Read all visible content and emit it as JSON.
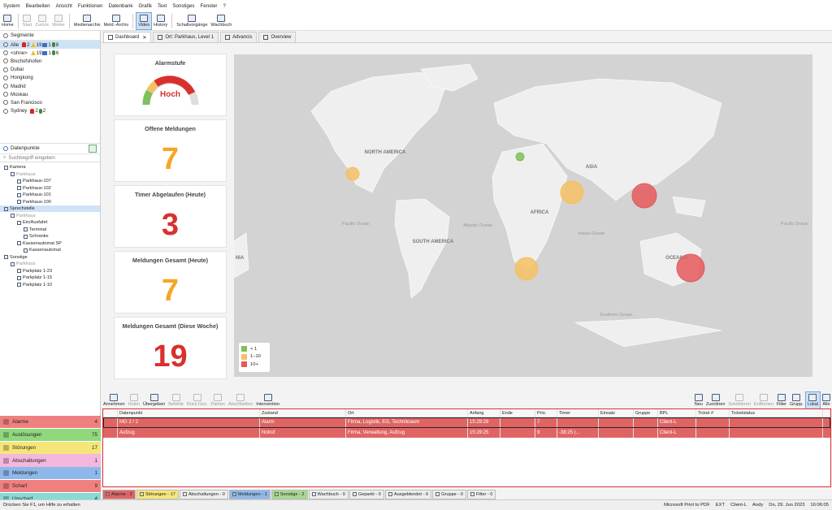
{
  "menu": [
    "System",
    "Bearbeiten",
    "Ansicht",
    "Funktionen",
    "Datenbank",
    "Grafik",
    "Text",
    "Sonstiges",
    "Fenster",
    "?"
  ],
  "toolbar": [
    {
      "label": "Home",
      "state": "normal"
    },
    {
      "label": "Start",
      "state": "disabled"
    },
    {
      "label": "Zurück",
      "state": "disabled"
    },
    {
      "label": "Weiter",
      "state": "disabled"
    },
    {
      "label": "Medienarchiv",
      "state": "normal"
    },
    {
      "label": "Meld.-Archiv",
      "state": "normal"
    },
    {
      "label": "Video",
      "state": "selected"
    },
    {
      "label": "History",
      "state": "normal"
    },
    {
      "label": "Schaltvorgänge",
      "state": "normal"
    },
    {
      "label": "Wachbuch",
      "state": "normal"
    }
  ],
  "segments": {
    "title": "Segmente",
    "items": [
      {
        "label": "Alle",
        "alarm": "2",
        "warn": "19",
        "msg": "1",
        "pin": "8",
        "selected": true
      },
      {
        "label": "<ohne>",
        "warn": "19",
        "msg": "1",
        "pin": "6"
      },
      {
        "label": "Bischofshofen"
      },
      {
        "label": "Dubai"
      },
      {
        "label": "Hongkong"
      },
      {
        "label": "Madrid"
      },
      {
        "label": "Moskau"
      },
      {
        "label": "San Francisco"
      },
      {
        "label": "Sydney",
        "alarm": "2",
        "pin": "2"
      }
    ]
  },
  "datapoints": {
    "title": "Datenpunkte",
    "search_placeholder": "Suchbegriff eingeben",
    "tree": [
      {
        "label": "Kamera",
        "indent": 0
      },
      {
        "label": "Parkhaus",
        "indent": 1,
        "grey": true
      },
      {
        "label": "Parkhaus-107",
        "indent": 2
      },
      {
        "label": "Parkhaus-102",
        "indent": 2
      },
      {
        "label": "Parkhaus-101",
        "indent": 2
      },
      {
        "label": "Parkhaus-100",
        "indent": 2
      },
      {
        "label": "Sprechstelle",
        "indent": 0,
        "selected": true
      },
      {
        "label": "Parkhaus",
        "indent": 1,
        "grey": true
      },
      {
        "label": "Ein/Ausfahrt",
        "indent": 2
      },
      {
        "label": "Terminal",
        "indent": 3
      },
      {
        "label": "Schranke",
        "indent": 3
      },
      {
        "label": "Kassenautomat SP",
        "indent": 2
      },
      {
        "label": "Kassenautomat",
        "indent": 3
      },
      {
        "label": "Sonstige",
        "indent": 0
      },
      {
        "label": "Parkhaus",
        "indent": 1,
        "grey": true
      },
      {
        "label": "Parkplatz 1-23",
        "indent": 2
      },
      {
        "label": "Parkplatz 1-15",
        "indent": 2
      },
      {
        "label": "Parkplatz 1-10",
        "indent": 2
      }
    ]
  },
  "categories": [
    {
      "label": "Alarme",
      "count": "4",
      "color": "#f08080"
    },
    {
      "label": "Auslösungen",
      "count": "75",
      "color": "#8fd87c"
    },
    {
      "label": "Störungen",
      "count": "17",
      "color": "#f5e67a"
    },
    {
      "label": "Abschaltungen",
      "count": "1",
      "color": "#f4b7dd"
    },
    {
      "label": "Meldungen",
      "count": "1",
      "color": "#8fb8ea"
    },
    {
      "label": "Scharf",
      "count": "9",
      "color": "#f08080"
    },
    {
      "label": "Unscharf",
      "count": "4",
      "color": "#86dbd6"
    }
  ],
  "tabs": [
    {
      "label": "Dashboard",
      "active": true
    },
    {
      "label": "Ort: Parkhaus, Level 1"
    },
    {
      "label": "Advancis"
    },
    {
      "label": "Overview"
    }
  ],
  "cards": [
    {
      "title": "Alarmstufe",
      "gauge": "Hoch"
    },
    {
      "title": "Offene Meldungen",
      "value": "7",
      "color": "#f5a623"
    },
    {
      "title": "Timer Abgelaufen (Heute)",
      "value": "3",
      "color": "#d9302e"
    },
    {
      "title": "Meldungen Gesamt (Heute)",
      "value": "7",
      "color": "#f5a623"
    },
    {
      "title": "Meldungen Gesamt (Diese Woche)",
      "value": "19",
      "color": "#d9302e"
    }
  ],
  "map": {
    "labels": [
      "NORTH AMERICA",
      "SOUTH AMERICA",
      "AFRICA",
      "ASIA",
      "OCEANIA",
      "Pacific Ocean",
      "Atlantic Ocean",
      "Indian Ocean",
      "Southern Ocean",
      "Pacific Ocean",
      "NIA"
    ],
    "legend": [
      {
        "label": "< 1",
        "color": "#7ebf5e"
      },
      {
        "label": "1–10",
        "color": "#f5c064"
      },
      {
        "label": "10+",
        "color": "#e5595d"
      }
    ]
  },
  "bottom_toolbar": [
    {
      "label": "Annehmen"
    },
    {
      "label": "Holen",
      "dis": true
    },
    {
      "label": "Übergeben"
    },
    {
      "label": "Befehle",
      "dis": true
    },
    {
      "label": "Rück.Ges.",
      "dis": true
    },
    {
      "label": "Parken",
      "dis": true
    },
    {
      "label": "Abschließen",
      "dis": true
    },
    {
      "label": "Intervention"
    }
  ],
  "bottom_toolbar_right": [
    {
      "label": "Neu"
    },
    {
      "label": "Zuordnen"
    },
    {
      "label": "Selektieren",
      "dis": true
    },
    {
      "label": "Entfernen",
      "dis": true
    },
    {
      "label": "Filter"
    },
    {
      "label": "Grupp."
    },
    {
      "label": "Lokal"
    },
    {
      "label": "Alle"
    }
  ],
  "grid": {
    "columns": [
      "",
      "Datenpunkt",
      "Zustand",
      "Ort",
      "Anfang",
      "Ende",
      "Prio.",
      "Timer",
      "Einsatz",
      "Gruppe",
      "BPL",
      "Ticket #",
      "Ticketstatus"
    ],
    "rows": [
      [
        "",
        "MG 2 / 2",
        "Alarm",
        "Firma, Logistik, EG, Technikraum",
        "15:29:28",
        "",
        "7",
        "",
        "",
        "",
        "Client-L",
        "",
        ""
      ],
      [
        "",
        "Aufzug",
        "Notruf",
        "Firma, Verwaltung, Aufzug",
        "15:29:25",
        "",
        "9",
        "-38:25 (...",
        "",
        "",
        "Client-L",
        "",
        ""
      ]
    ]
  },
  "bottom_tabs": [
    "Alarme - 2",
    "Störungen - 17",
    "Abschaltungen - 0",
    "Meldungen - 1",
    "Sonstige - 2",
    "Wachbuch - 0",
    "Geparkt - 0",
    "Ausgeblendet - 0",
    "Gruppe - 0",
    "Filter - 0"
  ],
  "status": {
    "hint": "Drücken Sie F1, um Hilfe zu erhalten",
    "printer": "Microsoft Print to PDF",
    "ext": "EXT",
    "client": "Client-L",
    "user": "Andy",
    "datetime": "Do, 29. Jun 2023",
    "time": "16:06:05"
  }
}
